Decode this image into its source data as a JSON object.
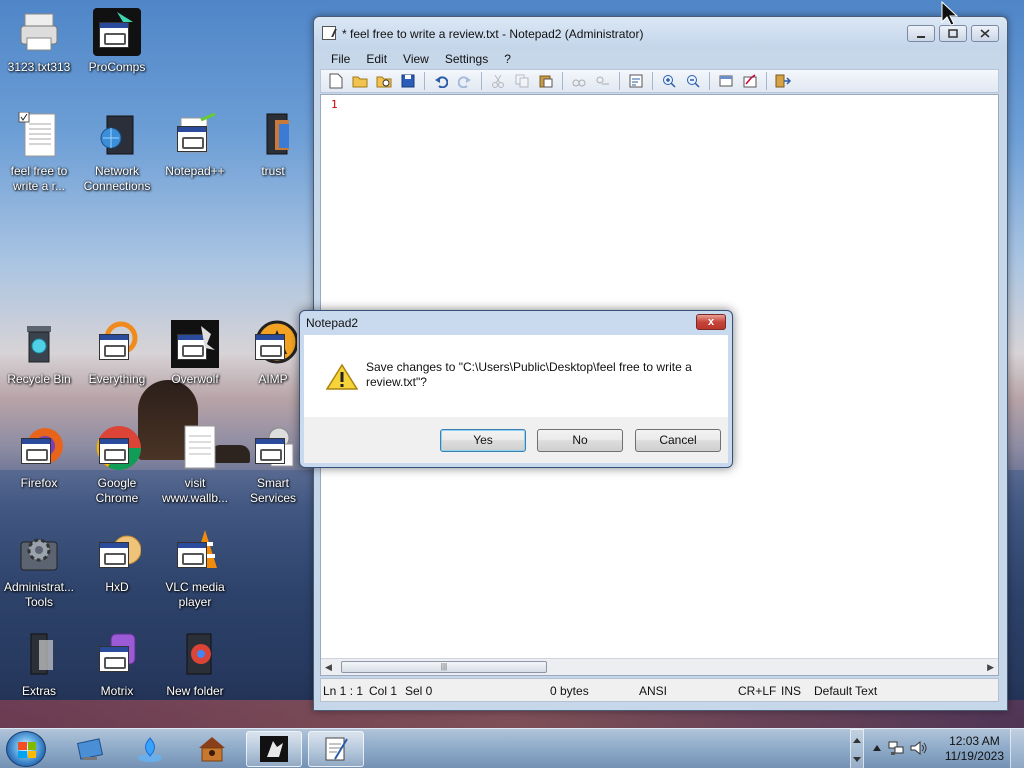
{
  "desktop": {
    "icons": [
      {
        "label": "3123.txt313"
      },
      {
        "label": "ProComps"
      },
      {
        "label": "feel free to write a r..."
      },
      {
        "label": "Network Connections"
      },
      {
        "label": "Notepad++"
      },
      {
        "label": "trust"
      },
      {
        "label": "Recycle Bin"
      },
      {
        "label": "Everything"
      },
      {
        "label": "Overwolf"
      },
      {
        "label": "AIMP"
      },
      {
        "label": "Firefox"
      },
      {
        "label": "Google Chrome"
      },
      {
        "label": "visit www.wallb..."
      },
      {
        "label": "Smart Services"
      },
      {
        "label": "Administrat... Tools"
      },
      {
        "label": "HxD"
      },
      {
        "label": "VLC media player"
      },
      {
        "label": "Extras"
      },
      {
        "label": "Motrix"
      },
      {
        "label": "New folder"
      }
    ]
  },
  "notepad": {
    "title": "* feel free to write a review.txt - Notepad2 (Administrator)",
    "menu": [
      "File",
      "Edit",
      "View",
      "Settings",
      "?"
    ],
    "line_number": "1",
    "scroll_thumb": "|||",
    "status": {
      "position": "Ln 1 : 1",
      "col": "Col 1",
      "sel": "Sel 0",
      "size": "0 bytes",
      "encoding": "ANSI",
      "eol": "CR+LF",
      "mode": "INS",
      "scheme": "Default Text"
    }
  },
  "dialog": {
    "title": "Notepad2",
    "close_glyph": "x",
    "message": "Save changes to \"C:\\Users\\Public\\Desktop\\feel free to write a review.txt\"?",
    "buttons": {
      "yes": "Yes",
      "no": "No",
      "cancel": "Cancel"
    }
  },
  "taskbar": {
    "clock_time": "12:03 AM",
    "clock_date": "11/19/2023"
  }
}
